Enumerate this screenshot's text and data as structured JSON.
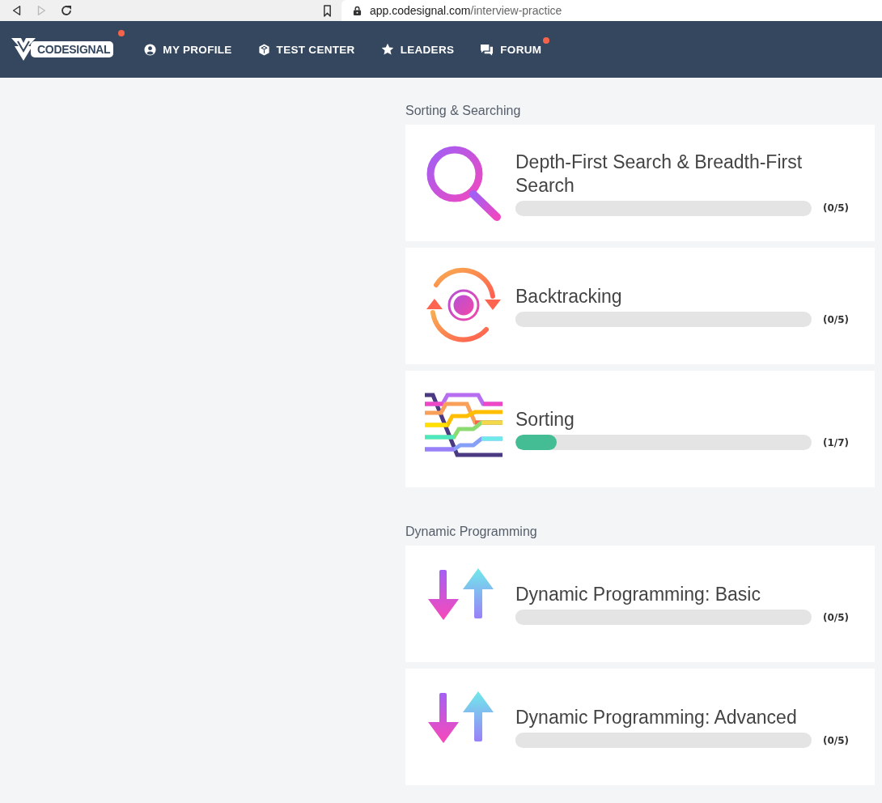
{
  "browser": {
    "back_disabled": false,
    "forward_disabled": true,
    "url_host": "app.codesignal.com",
    "url_path": "/interview-practice"
  },
  "nav": {
    "logo": "CODESIGNAL",
    "logo_notify": true,
    "items": [
      {
        "label": "MY PROFILE",
        "kind": "profile",
        "notify": false
      },
      {
        "label": "TEST CENTER",
        "kind": "test",
        "notify": false
      },
      {
        "label": "LEADERS",
        "kind": "leaders",
        "notify": false
      },
      {
        "label": "FORUM",
        "kind": "forum",
        "notify": true
      }
    ]
  },
  "sections": [
    {
      "title": "Sorting & Searching",
      "topics": [
        {
          "title": "Depth-First Search & Breadth-First Search",
          "kind": "search",
          "level": 0,
          "count": "(0/5)"
        },
        {
          "title": "Backtracking",
          "kind": "backtracking",
          "level": 0,
          "count": "(0/5)"
        },
        {
          "title": "Sorting",
          "kind": "sorting",
          "level": 0.14,
          "count": "(1/7)"
        }
      ]
    },
    {
      "title": "Dynamic Programming",
      "topics": [
        {
          "title": "Dynamic Programming: Basic",
          "kind": "dp",
          "level": 0,
          "count": "(0/5)"
        },
        {
          "title": "Dynamic Programming: Advanced",
          "kind": "dp",
          "level": 0,
          "count": "(0/5)"
        }
      ]
    }
  ]
}
